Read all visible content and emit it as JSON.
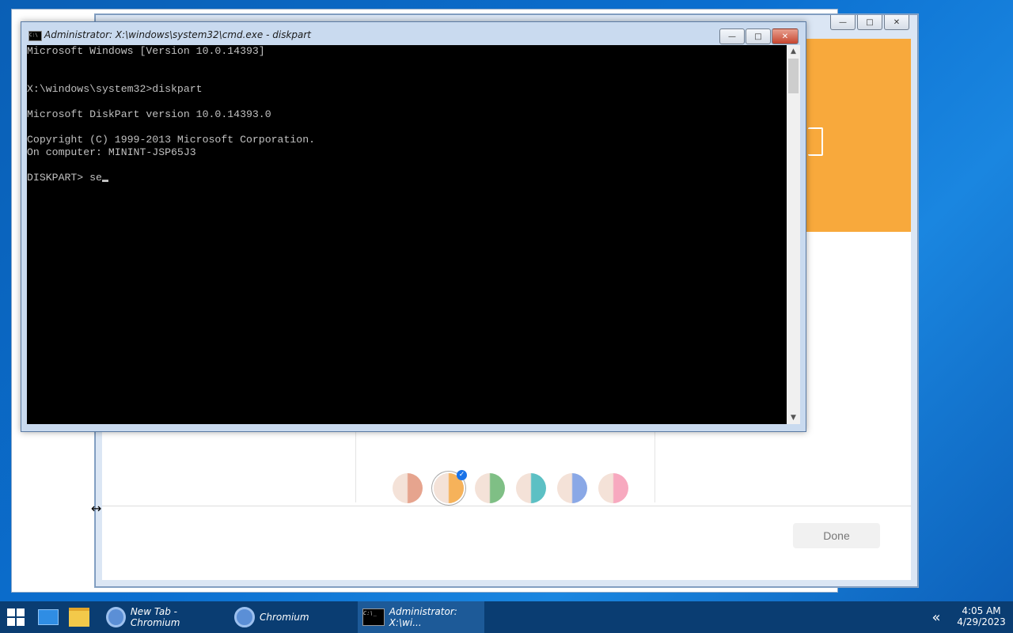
{
  "cmd_window": {
    "title": "Administrator: X:\\windows\\system32\\cmd.exe - diskpart",
    "console_lines": [
      "Microsoft Windows [Version 10.0.14393]",
      "",
      "",
      "X:\\windows\\system32>diskpart",
      "",
      "Microsoft DiskPart version 10.0.14393.0",
      "",
      "Copyright (C) 1999-2013 Microsoft Corporation.",
      "On computer: MININT-JSP65J3",
      "",
      "DISKPART> se"
    ]
  },
  "background_dialog": {
    "done_label": "Done",
    "accent_color": "#f8a93c",
    "swatch_colors": [
      "#e6a48e",
      "#f6b25a",
      "#7fbf85",
      "#5cc0c4",
      "#8aa8e6",
      "#f7a9bf"
    ],
    "selected_swatch": 1
  },
  "taskbar": {
    "items": [
      {
        "label": "New Tab - Chromium",
        "icon": "chromium-icon"
      },
      {
        "label": "Chromium",
        "icon": "chromium-icon"
      },
      {
        "label": "Administrator: X:\\wi...",
        "icon": "cmd-icon"
      }
    ],
    "time": "4:05 AM",
    "date": "4/29/2023"
  }
}
